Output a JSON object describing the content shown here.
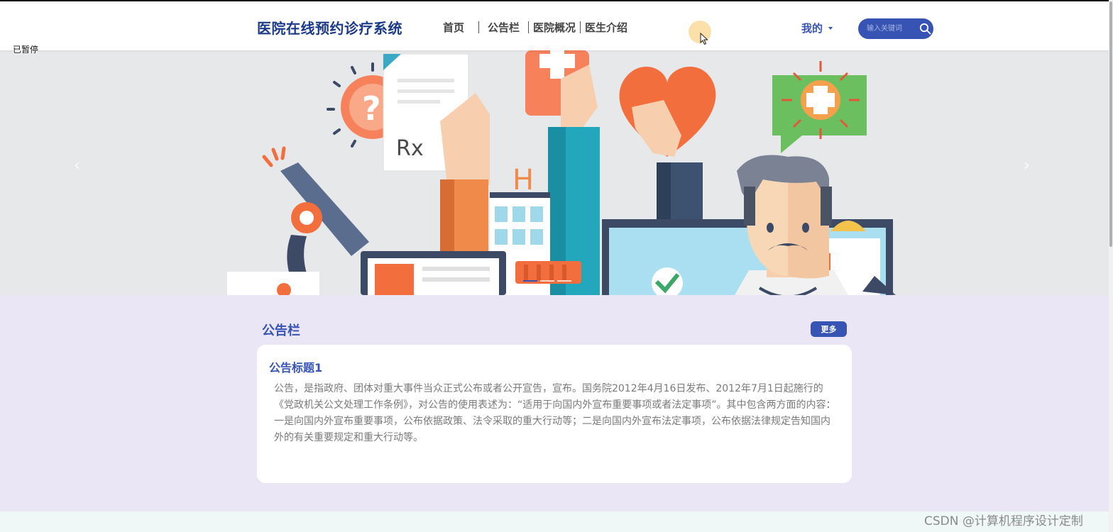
{
  "header": {
    "site_title": "医院在线预约诊疗系统",
    "nav": [
      "首页",
      "公告栏",
      "医院概况",
      "医生介绍"
    ],
    "my_label": "我的",
    "search_placeholder": "输入关键词"
  },
  "overlay": {
    "paused_label": "已暂停"
  },
  "banner": {
    "prev_label": "‹",
    "next_label": "›",
    "slide_count": 3,
    "active_slide": 1
  },
  "notice": {
    "section_title": "公告栏",
    "more_label": "更多",
    "items": [
      {
        "title": "公告标题1",
        "body": "公告，是指政府、团体对重大事件当众正式公布或者公开宣告，宣布。国务院2012年4月16日发布、2012年7月1日起施行的《党政机关公文处理工作条例》，对公告的使用表述为：“适用于向国内外宣布重要事项或者法定事项”。其中包含两方面的内容：一是向国内外宣布重要事项，公布依据政策、法令采取的重大行动等；二是向国内外宣布法定事项，公布依据法律规定告知国内外的有关重要规定和重大行动等。"
      }
    ]
  },
  "watermark": "CSDN @计算机程序设计定制",
  "colors": {
    "brand": "#3754b5",
    "title": "#1b3a8a",
    "section_bg": "#ebe6f6",
    "banner_bg": "#e7e8ea"
  }
}
